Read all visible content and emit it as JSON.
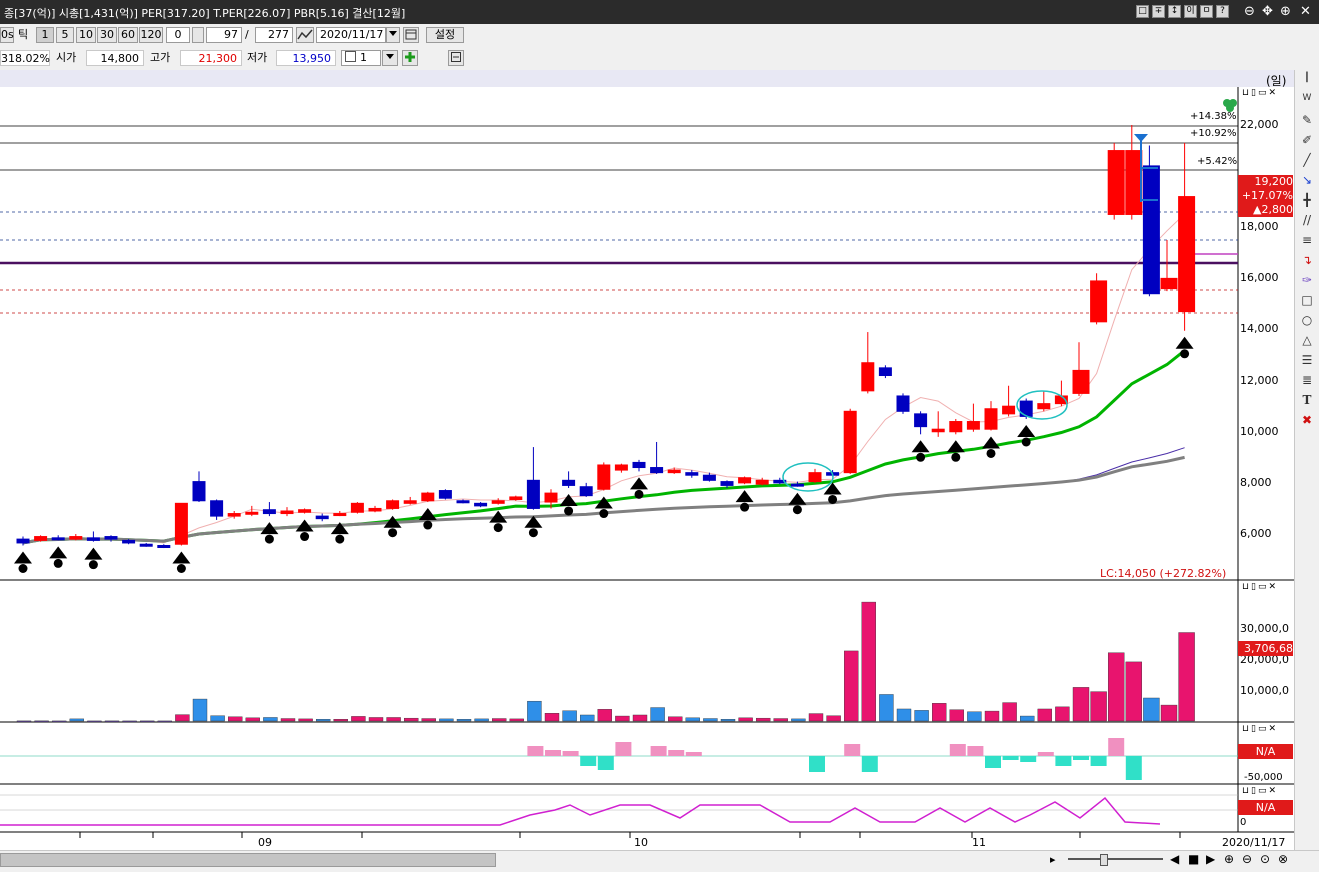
{
  "titlebar": {
    "title": "종[37(억)] 시총[1,431(억)] PER[317.20] T.PER[226.07] PBR[5.16] 결산[12월]",
    "window_buttons": [
      "□",
      "∓",
      "↕",
      "이",
      "ㅁ",
      "?"
    ],
    "control_buttons": [
      "⊖",
      "✥",
      "⊕",
      "✕"
    ]
  },
  "toolbar1": {
    "period_unit": "0s",
    "tick_label": "틱",
    "intervals": [
      "1",
      "5",
      "10",
      "30",
      "60",
      "120"
    ],
    "field_a": "0",
    "field_b": "97",
    "separator": "/",
    "field_c": "277",
    "date": "2020/11/17",
    "settings_label": "설정"
  },
  "toolbar2": {
    "change_pct": "318.02%",
    "open_label": "시가",
    "open_value": "14,800",
    "high_label": "고가",
    "high_value": "21,300",
    "low_label": "저가",
    "low_value": "13,950",
    "count_value": "1"
  },
  "main_chart": {
    "unit_label": "(일)",
    "y_ticks": [
      "22,000",
      "18,000",
      "16,000",
      "14,000",
      "12,000",
      "10,000",
      "8,000",
      "6,000"
    ],
    "y_tick_values": [
      22000,
      18000,
      16000,
      14000,
      12000,
      10000,
      8000,
      6000
    ],
    "pct_labels": [
      "+14.38%",
      "+10.92%",
      "+5.42%"
    ],
    "price_tag": {
      "price": "19,200",
      "pct": "+17.07%",
      "change": "▲2,800"
    },
    "lc_label": "LC:14,050 (+272.82%)",
    "icon_hint": "clover-icon"
  },
  "volume_chart": {
    "y_ticks": [
      "30,000,0",
      "20,000,0",
      "10,000,0"
    ],
    "current_tag": "3,706,68"
  },
  "indicator1": {
    "tag": "N/A",
    "tick": "-50,000"
  },
  "indicator2": {
    "tag": "N/A",
    "tick": "0"
  },
  "x_axis": {
    "labels": [
      "09",
      "10",
      "11"
    ],
    "end_date": "2020/11/17"
  },
  "colors": {
    "up": "#ff0000",
    "down": "#0000c0",
    "ma_green": "#00b400",
    "ma_purple": "#4a2ea8",
    "ma_gray": "#808080",
    "volume_up": "#e8146e",
    "volume_down": "#2f8fe8"
  },
  "chart_data": {
    "type": "candlestick",
    "y_range": [
      5400,
      23000
    ],
    "candles": [
      [
        5800,
        5650,
        5900,
        5550
      ],
      [
        5750,
        5900,
        5950,
        5700
      ],
      [
        5850,
        5800,
        5950,
        5750
      ],
      [
        5800,
        5900,
        6000,
        5750
      ],
      [
        5850,
        5750,
        6100,
        5700
      ],
      [
        5900,
        5800,
        5950,
        5700
      ],
      [
        5750,
        5650,
        5800,
        5600
      ],
      [
        5600,
        5550,
        5650,
        5500
      ],
      [
        5550,
        5500,
        5600,
        5450
      ],
      [
        5600,
        7200,
        7200,
        5550
      ],
      [
        8050,
        7300,
        8450,
        7250
      ],
      [
        7300,
        6700,
        7350,
        6550
      ],
      [
        6700,
        6800,
        6900,
        6600
      ],
      [
        6800,
        6850,
        7100,
        6700
      ],
      [
        6950,
        6800,
        7250,
        6700
      ],
      [
        6800,
        6900,
        7050,
        6700
      ],
      [
        6850,
        6950,
        7000,
        6800
      ],
      [
        6700,
        6600,
        6800,
        6500
      ],
      [
        6750,
        6800,
        6900,
        6700
      ],
      [
        6850,
        7200,
        7250,
        6800
      ],
      [
        6900,
        7000,
        7100,
        6850
      ],
      [
        7000,
        7300,
        7350,
        6950
      ],
      [
        7200,
        7300,
        7450,
        7150
      ],
      [
        7300,
        7600,
        7650,
        7250
      ],
      [
        7700,
        7400,
        7750,
        7350
      ],
      [
        7300,
        7250,
        7350,
        7200
      ],
      [
        7200,
        7100,
        7250,
        7050
      ],
      [
        7200,
        7300,
        7400,
        7150
      ],
      [
        7350,
        7450,
        7500,
        7300
      ],
      [
        8100,
        7000,
        9400,
        6950
      ],
      [
        7250,
        7600,
        7750,
        7000
      ],
      [
        8100,
        7900,
        8450,
        7800
      ],
      [
        7850,
        7500,
        8000,
        7450
      ],
      [
        7750,
        8700,
        8800,
        7700
      ],
      [
        8500,
        8700,
        8750,
        8400
      ],
      [
        8800,
        8600,
        8900,
        8450
      ],
      [
        8600,
        8400,
        9600,
        8350
      ],
      [
        8400,
        8500,
        8600,
        8350
      ],
      [
        8400,
        8300,
        8500,
        8200
      ],
      [
        8300,
        8100,
        8400,
        8050
      ],
      [
        8050,
        7900,
        8100,
        7800
      ],
      [
        8000,
        8200,
        8250,
        7950
      ],
      [
        7950,
        8100,
        8200,
        7900
      ],
      [
        8100,
        8000,
        8200,
        7950
      ],
      [
        7950,
        7900,
        8050,
        7850
      ],
      [
        8050,
        8400,
        8550,
        8000
      ],
      [
        8400,
        8300,
        8500,
        8250
      ],
      [
        8400,
        10800,
        10900,
        8350
      ],
      [
        11600,
        12700,
        13900,
        11500
      ],
      [
        12500,
        12200,
        12600,
        12100
      ],
      [
        11400,
        10800,
        11500,
        10700
      ],
      [
        10700,
        10200,
        10800,
        9900
      ],
      [
        10000,
        10100,
        10800,
        9800
      ],
      [
        10000,
        10400,
        10500,
        9900
      ],
      [
        10100,
        10400,
        11100,
        10000
      ],
      [
        10100,
        10900,
        11200,
        10050
      ],
      [
        10700,
        11000,
        11800,
        10600
      ],
      [
        11200,
        10600,
        11300,
        10500
      ],
      [
        10900,
        11100,
        11600,
        10800
      ],
      [
        11100,
        11400,
        12000,
        11000
      ],
      [
        11500,
        12400,
        13500,
        11400
      ],
      [
        14300,
        15900,
        16200,
        14200
      ],
      [
        18500,
        21000,
        21300,
        18300
      ],
      [
        18500,
        21000,
        22000,
        18300
      ],
      [
        20400,
        15400,
        21200,
        15300
      ],
      [
        15600,
        16000,
        17500,
        15500
      ],
      [
        14700,
        19200,
        21300,
        13950
      ]
    ],
    "volumes": [
      [
        40000,
        "n"
      ],
      [
        50000,
        "n"
      ],
      [
        30000,
        "n"
      ],
      [
        600000,
        "d"
      ],
      [
        30000,
        "n"
      ],
      [
        40000,
        "n"
      ],
      [
        30000,
        "n"
      ],
      [
        40000,
        "n"
      ],
      [
        30000,
        "n"
      ],
      [
        1800000,
        "u"
      ],
      [
        6200000,
        "d"
      ],
      [
        1500000,
        "d"
      ],
      [
        1200000,
        "u"
      ],
      [
        900000,
        "u"
      ],
      [
        1000000,
        "d"
      ],
      [
        700000,
        "u"
      ],
      [
        600000,
        "u"
      ],
      [
        500000,
        "d"
      ],
      [
        500000,
        "u"
      ],
      [
        1300000,
        "u"
      ],
      [
        1000000,
        "u"
      ],
      [
        1000000,
        "u"
      ],
      [
        800000,
        "u"
      ],
      [
        700000,
        "u"
      ],
      [
        600000,
        "d"
      ],
      [
        500000,
        "d"
      ],
      [
        600000,
        "d"
      ],
      [
        700000,
        "u"
      ],
      [
        600000,
        "u"
      ],
      [
        5600000,
        "d"
      ],
      [
        2200000,
        "u"
      ],
      [
        2900000,
        "d"
      ],
      [
        1700000,
        "d"
      ],
      [
        3300000,
        "u"
      ],
      [
        1400000,
        "u"
      ],
      [
        1700000,
        "u"
      ],
      [
        3800000,
        "d"
      ],
      [
        1200000,
        "u"
      ],
      [
        900000,
        "d"
      ],
      [
        700000,
        "d"
      ],
      [
        500000,
        "d"
      ],
      [
        900000,
        "u"
      ],
      [
        800000,
        "u"
      ],
      [
        700000,
        "u"
      ],
      [
        600000,
        "d"
      ],
      [
        2100000,
        "u"
      ],
      [
        1500000,
        "u"
      ],
      [
        19800000,
        "u"
      ],
      [
        33600000,
        "u"
      ],
      [
        7500000,
        "d"
      ],
      [
        3400000,
        "d"
      ],
      [
        3000000,
        "d"
      ],
      [
        5000000,
        "u"
      ],
      [
        3200000,
        "u"
      ],
      [
        2600000,
        "d"
      ],
      [
        2800000,
        "u"
      ],
      [
        5200000,
        "u"
      ],
      [
        1400000,
        "d"
      ],
      [
        3400000,
        "u"
      ],
      [
        4000000,
        "u"
      ],
      [
        9500000,
        "u"
      ],
      [
        8300000,
        "u"
      ],
      [
        19300000,
        "u"
      ],
      [
        16700000,
        "u"
      ],
      [
        6500000,
        "d"
      ],
      [
        4500000,
        "u"
      ],
      [
        25000000,
        "u"
      ]
    ],
    "volume_range": [
      0,
      40000000
    ]
  }
}
